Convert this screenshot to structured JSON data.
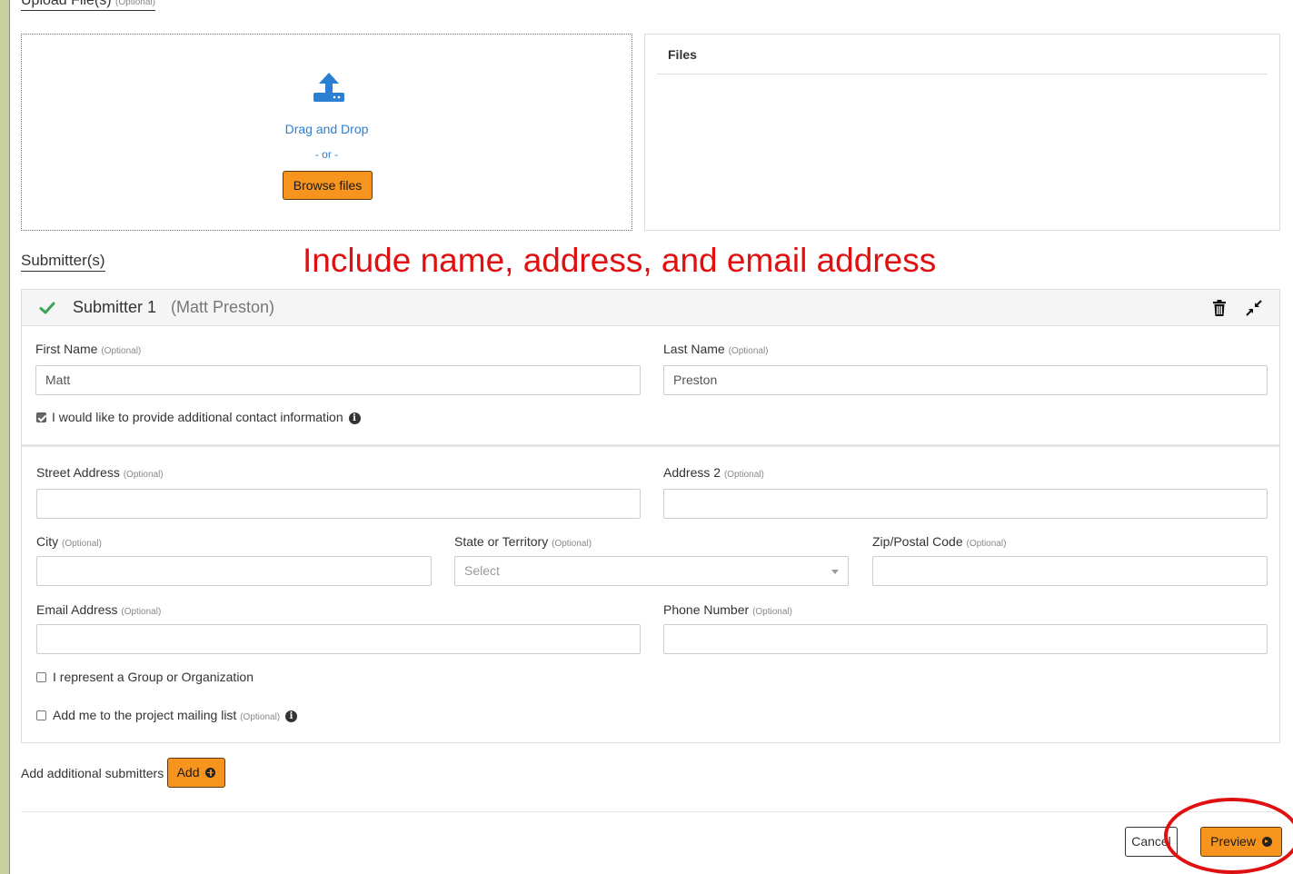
{
  "upload": {
    "heading": "Upload File(s)",
    "optional": "(Optional)",
    "drag_text": "Drag and Drop",
    "or_text": "- or -",
    "browse_label": "Browse files",
    "icon": "upload-icon"
  },
  "files": {
    "title": "Files"
  },
  "submitters": {
    "heading": "Submitter(s)",
    "annotation": "Include name, address, and email address"
  },
  "submitter1": {
    "title": "Submitter 1",
    "name": "(Matt Preston)",
    "first_name_label": "First Name",
    "first_name_value": "Matt",
    "last_name_label": "Last Name",
    "last_name_value": "Preston",
    "optional": "(Optional)",
    "additional_contact_label": "I would like to provide additional contact information",
    "additional_contact_checked": true,
    "street_label": "Street Address",
    "address2_label": "Address 2",
    "city_label": "City",
    "state_label": "State or Territory",
    "state_placeholder": "Select",
    "zip_label": "Zip/Postal Code",
    "email_label": "Email Address",
    "phone_label": "Phone Number",
    "group_label": "I represent a Group or Organization",
    "mailing_label": "Add me to the project mailing list"
  },
  "actions": {
    "add_text": "Add additional submitters",
    "add_label": "Add",
    "cancel_label": "Cancel",
    "preview_label": "Preview"
  },
  "colors": {
    "accent_orange": "#f7941d",
    "link_blue": "#2a7fd3",
    "annotation_red": "#e01010",
    "check_green": "#3aa655"
  }
}
